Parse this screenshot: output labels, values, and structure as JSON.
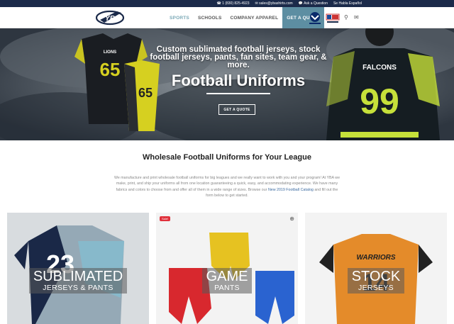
{
  "topbar": {
    "phone": "1 (830) 825-4923",
    "email": "sales@ybashirts.com",
    "ask": "Ask a Question",
    "spanish": "Se Habla Español"
  },
  "nav": {
    "items": [
      "SPORTS",
      "SCHOOLS",
      "COMPANY APPAREL",
      "GET A QUOTE"
    ]
  },
  "hero": {
    "subtitle": "Custom sublimated football jerseys, stock football jerseys, pants, fan sites, team gear, & more.",
    "title": "Football Uniforms",
    "button": "GET A QUOTE",
    "left_jersey_team": "LIONS",
    "left_jersey_number": "65",
    "right_jersey_team": "FALCONS",
    "right_jersey_number": "99"
  },
  "section": {
    "title": "Wholesale Football Uniforms for Your League",
    "intro_1": "We manufacture and print wholesale football uniforms for big leagues and we really want to work with you and your program! At YBA we make, print, and ship your uniforms all from one location guaranteeing a quick, easy, and accommodating experience. We have many fabrics and colors to choose from and offer all of them in a wide range of sizes. Browse our",
    "intro_link": "New 2019 Football Catalog",
    "intro_2": "and fill out the form below to get started."
  },
  "cards": [
    {
      "big": "SUBLIMATED",
      "small": "JERSEYS & PANTS",
      "jersey_number": "23"
    },
    {
      "big": "GAME",
      "small": "PANTS",
      "badge": "Sale!"
    },
    {
      "big": "STOCK",
      "small": "JERSEYS",
      "jersey_team": "WARRIORS",
      "jersey_number": "14"
    }
  ],
  "colors": {
    "topbar": "#1b2a4a",
    "nav_active": "#7aa8b6",
    "quote_button": "#5d8ea2",
    "sale_badge": "#e0303b"
  }
}
